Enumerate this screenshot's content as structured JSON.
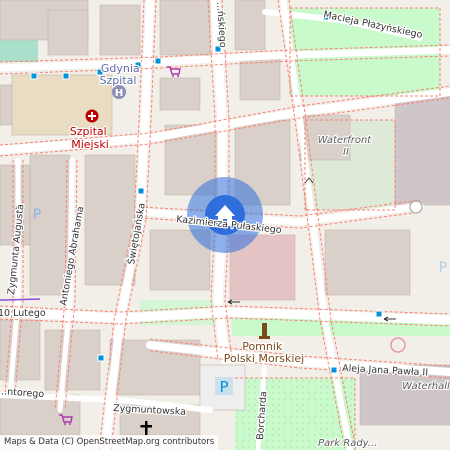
{
  "map": {
    "colors": {
      "background": "#f2efe9",
      "building": "#d9d0c9",
      "road": "#ffffff",
      "park": "#c8facc",
      "sidewalk": "#fa8072",
      "transit_stop": "#0092da",
      "hospital": "#bf0000",
      "location_marker": "#2f6fdc"
    },
    "streets": {
      "plazynskiego": "Macieja Płażyńskiego",
      "top_road": "...ńskiego",
      "kazimierza": "Kazimierza Pułaskiego",
      "swietojanska": "Świętojańska",
      "augusta": "Zygmunta Augusta",
      "abrahama": "Antoniego Abrahama",
      "lutego": "10 Lutego",
      "pawla": "Aleja Jana Pawła II",
      "zygmuntowska": "Zygmuntowska",
      "borcharda": "Borcharda",
      "antorego": "...ntorego"
    },
    "pois": {
      "gdynia_szpital": "Gdynia\nSzpital",
      "szpital_miejski": "Szpital\nMiejski",
      "waterfront": "Waterfront\nII",
      "pomnik": "Pomnik\nPolski Morskiej",
      "waterhall": "Waterhall",
      "park_rady": "Park Rady..."
    },
    "icons": {
      "location_marker": "home-icon",
      "hospital": "hospital-cross-icon",
      "hospital_h": "hospital-h-icon",
      "parking": "parking-icon",
      "shop": "shopping-cart-icon",
      "monument": "monument-icon",
      "church": "church-cross-icon"
    },
    "attribution": "Maps & Data (C) OpenStreetMap.org contributors"
  }
}
